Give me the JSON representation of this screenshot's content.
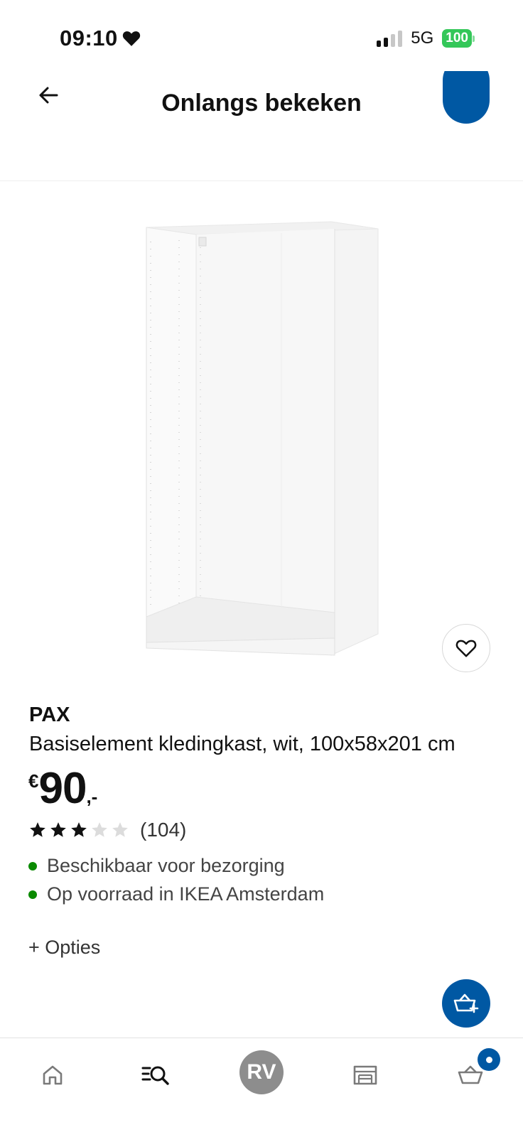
{
  "status_bar": {
    "time": "09:10",
    "network": "5G",
    "battery": "100"
  },
  "header": {
    "title": "Onlangs bekeken"
  },
  "product": {
    "brand": "PAX",
    "description": "Basiselement kledingkast, wit, 100x58x201 cm",
    "price": {
      "currency": "€",
      "integer": "90",
      "decimals": ",-"
    },
    "rating": {
      "stars": 3,
      "max_stars": 5,
      "count": "(104)"
    },
    "availability": [
      "Beschikbaar voor bezorging",
      "Op voorraad in IKEA Amsterdam"
    ],
    "options_label": "+ Opties"
  },
  "bottom_nav": {
    "items": [
      {
        "icon": "home-icon"
      },
      {
        "icon": "search-list-icon"
      },
      {
        "icon": "profile-avatar",
        "initials": "RV"
      },
      {
        "icon": "store-icon"
      },
      {
        "icon": "cart-icon"
      }
    ]
  },
  "colors": {
    "accent": "#0058a3",
    "available": "#0a8a00",
    "battery": "#34c759",
    "avatar": "#8d8d8d"
  }
}
